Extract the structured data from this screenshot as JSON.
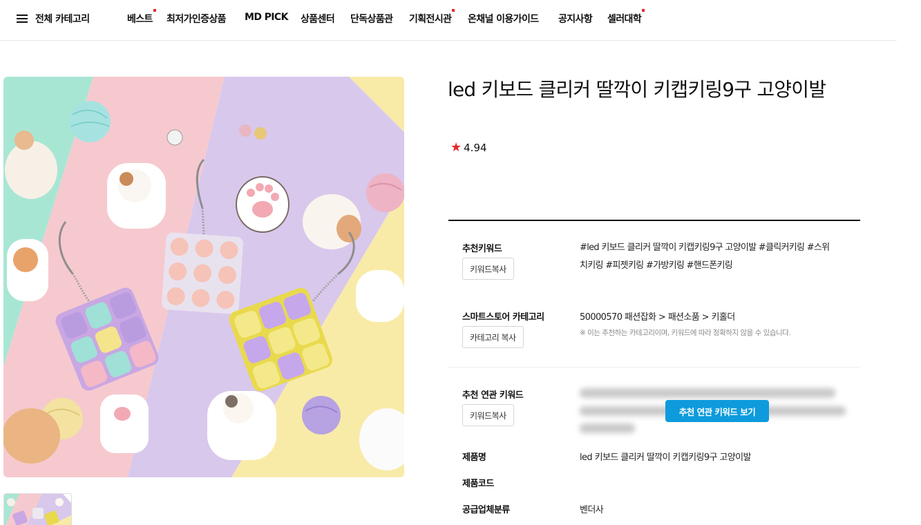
{
  "nav": {
    "menu_label": "전체 카테고리",
    "items": [
      {
        "label": "베스트",
        "dot": true
      },
      {
        "label": "최저가인증상품",
        "dot": false
      },
      {
        "label": "MD PICK",
        "dot": false
      },
      {
        "label": "상품센터",
        "dot": false
      },
      {
        "label": "단독상품관",
        "dot": false
      },
      {
        "label": "기획전시관",
        "dot": true
      },
      {
        "label": "온채널 이용가이드",
        "dot": false
      },
      {
        "label": "공지사항",
        "dot": false
      },
      {
        "label": "셀러대학",
        "dot": true
      }
    ]
  },
  "product": {
    "title": "led 키보드 클리커 딸깍이 키캡키링9구 고양이발",
    "rating": "4.94"
  },
  "details": {
    "keyword_label": "추천키워드",
    "keyword_copy_button": "키워드복사",
    "keywords_line1": "#led 키보드 클리커 딸깍이 키캡키링9구 고양이발 #클릭커키링 #스위",
    "keywords_line2": "치키링 #피젯키링 #가방키링 #핸드폰키링",
    "category_label": "스마트스토어 카테고리",
    "category_copy_button": "카테고리 복사",
    "category_value": "50000570 패션잡화 > 패션소품 > 키홀더",
    "category_note": "※ 이는 추천하는 카테고리이며, 키워드에 따라 정확하지 않을 수 있습니다.",
    "related_label": "추천 연관 키워드",
    "related_copy_button": "키워드복사",
    "related_view_button": "추천 연관 키워드 보기",
    "name_label": "제품명",
    "name_value": "led 키보드 클리커 딸깍이 키캡키링9구 고양이발",
    "code_label": "제품코드",
    "code_value": "",
    "supplier_label": "공급업체분류",
    "supplier_value": "벤더사"
  },
  "colors": {
    "accent_red": "#e8262c",
    "button_blue": "#0e9bdd"
  },
  "icons": {
    "menu": "hamburger-icon",
    "rating": "star-icon"
  }
}
